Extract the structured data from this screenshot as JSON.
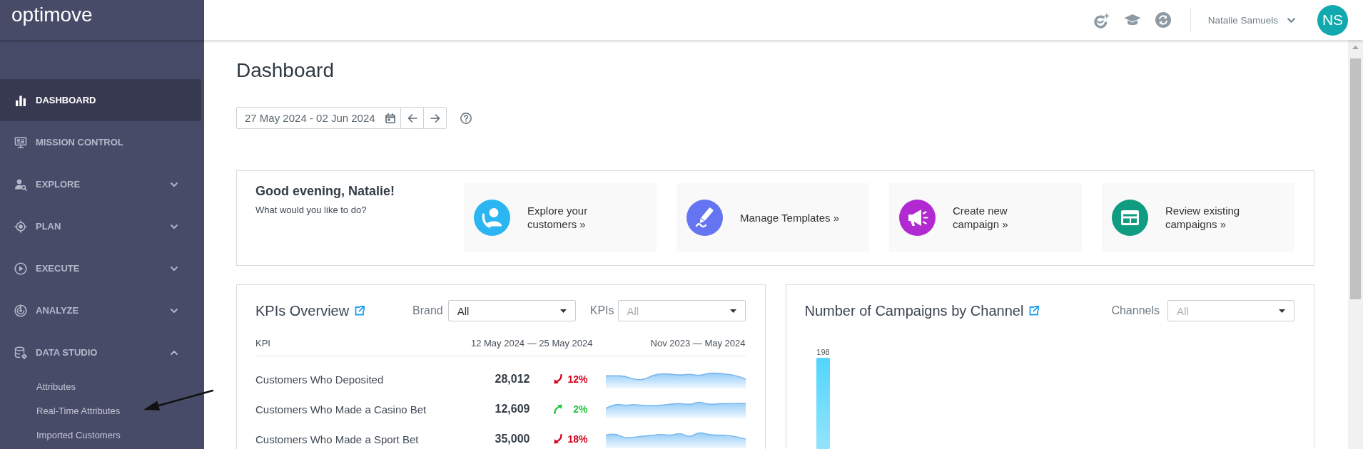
{
  "sidebar": {
    "logo": "optimove",
    "items": [
      {
        "label": "DASHBOARD",
        "kind": "link",
        "selected": true
      },
      {
        "label": "MISSION CONTROL",
        "kind": "link",
        "selected": false
      },
      {
        "label": "EXPLORE",
        "kind": "group",
        "selected": false,
        "expanded": false
      },
      {
        "label": "PLAN",
        "kind": "group",
        "selected": false,
        "expanded": false
      },
      {
        "label": "EXECUTE",
        "kind": "group",
        "selected": false,
        "expanded": false
      },
      {
        "label": "ANALYZE",
        "kind": "group",
        "selected": false,
        "expanded": false
      },
      {
        "label": "DATA STUDIO",
        "kind": "group",
        "selected": false,
        "expanded": true,
        "children": [
          {
            "label": "Attributes",
            "selected": false
          },
          {
            "label": "Real-Time Attributes",
            "selected": false
          },
          {
            "label": "Imported Customers",
            "selected": false
          }
        ]
      }
    ]
  },
  "top_bar": {
    "user_name": "Natalie Samuels",
    "avatar_initials": "NS"
  },
  "page": {
    "title": "Dashboard",
    "date_range": "27 May 2024 - 02 Jun 2024"
  },
  "welcome": {
    "greeting": "Good evening, Natalie!",
    "prompt": "What would you like to do?",
    "actions": [
      {
        "label": "Explore your customers »",
        "color": "#2cb6f1"
      },
      {
        "label": "Manage Templates »",
        "color": "#6575f1"
      },
      {
        "label": "Create new campaign »",
        "color": "#b12ad1"
      },
      {
        "label": "Review existing campaigns »",
        "color": "#0f9c80"
      }
    ]
  },
  "kpis": {
    "title": "KPIs Overview",
    "filters": [
      {
        "label": "Brand",
        "value": "All"
      },
      {
        "label": "KPIs",
        "placeholder": "All"
      }
    ],
    "columns": [
      "KPI",
      "12 May 2024 — 25 May 2024",
      "Nov 2023 — May 2024"
    ],
    "rows": [
      {
        "name": "Customers Who Deposited",
        "value": "28,012",
        "rising": false,
        "change": "12%"
      },
      {
        "name": "Customers Who Made a Casino Bet",
        "value": "12,609",
        "rising": true,
        "change": "2%"
      },
      {
        "name": "Customers Who Made a Sport Bet",
        "value": "35,000",
        "rising": false,
        "change": "18%"
      }
    ]
  },
  "campaigns": {
    "title": "Number of Campaigns by Channel",
    "filter": {
      "label": "Channels",
      "placeholder": "All"
    },
    "bars": [
      {
        "value_label": "198"
      }
    ]
  }
}
